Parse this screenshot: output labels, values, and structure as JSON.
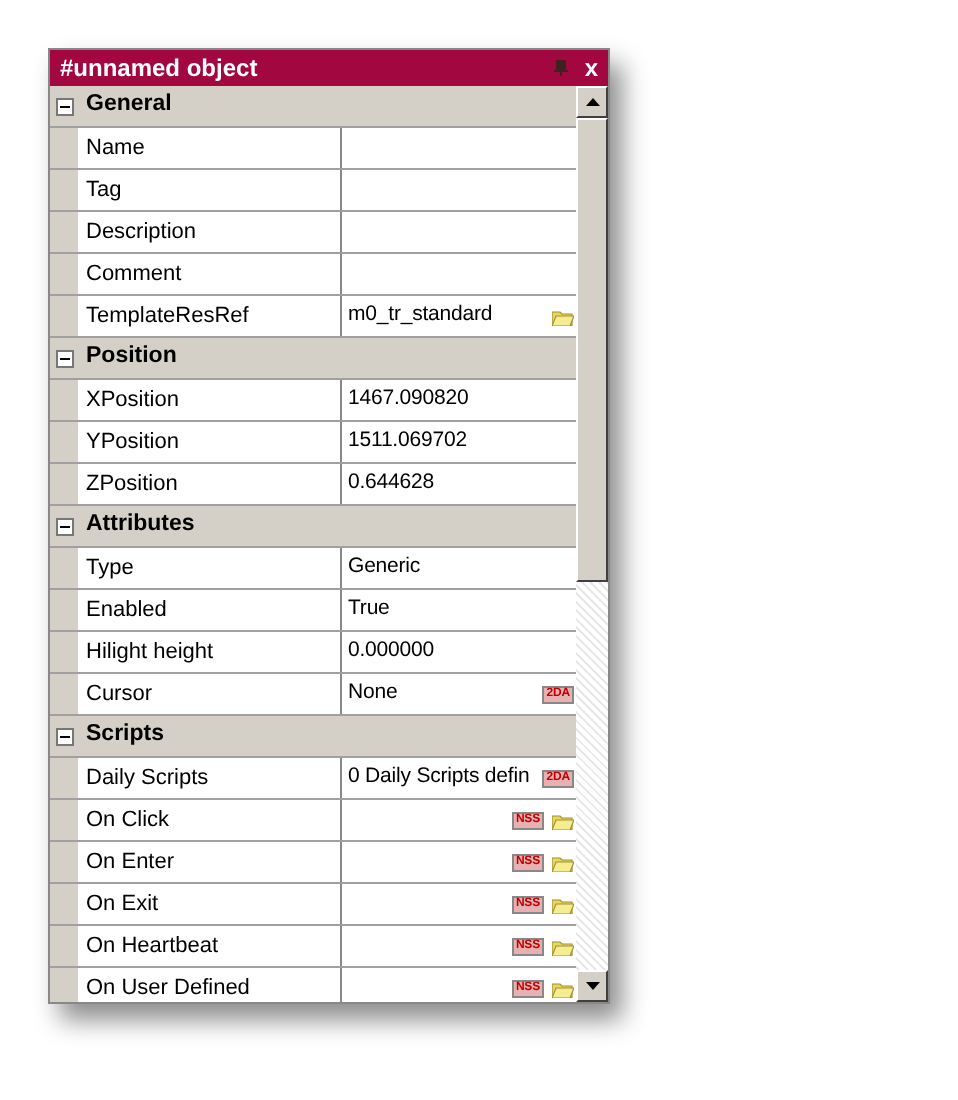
{
  "window": {
    "title": "#unnamed object",
    "close": "x"
  },
  "groups": [
    {
      "title": "General",
      "expanded": true,
      "rows": [
        {
          "name": "Name",
          "value": ""
        },
        {
          "name": "Tag",
          "value": ""
        },
        {
          "name": "Description",
          "value": ""
        },
        {
          "name": "Comment",
          "value": ""
        },
        {
          "name": "TemplateResRef",
          "value": "m0_tr_standard",
          "icons": [
            {
              "kind": "folder"
            }
          ]
        }
      ]
    },
    {
      "title": "Position",
      "expanded": true,
      "rows": [
        {
          "name": "XPosition",
          "value": "1467.090820"
        },
        {
          "name": "YPosition",
          "value": "1511.069702"
        },
        {
          "name": "ZPosition",
          "value": "0.644628"
        }
      ]
    },
    {
      "title": "Attributes",
      "expanded": true,
      "rows": [
        {
          "name": "Type",
          "value": "Generic"
        },
        {
          "name": "Enabled",
          "value": "True"
        },
        {
          "name": "Hilight height",
          "value": "0.000000"
        },
        {
          "name": "Cursor",
          "value": "None",
          "icons": [
            {
              "kind": "badge",
              "label": "2DA"
            }
          ]
        }
      ]
    },
    {
      "title": "Scripts",
      "expanded": true,
      "rows": [
        {
          "name": "Daily Scripts",
          "value": "0 Daily Scripts defin",
          "icons": [
            {
              "kind": "badge",
              "label": "2DA"
            }
          ]
        },
        {
          "name": "On Click",
          "value": "",
          "icons": [
            {
              "kind": "badge",
              "label": "NSS"
            },
            {
              "kind": "folder"
            }
          ]
        },
        {
          "name": "On Enter",
          "value": "",
          "icons": [
            {
              "kind": "badge",
              "label": "NSS"
            },
            {
              "kind": "folder"
            }
          ]
        },
        {
          "name": "On Exit",
          "value": "",
          "icons": [
            {
              "kind": "badge",
              "label": "NSS"
            },
            {
              "kind": "folder"
            }
          ]
        },
        {
          "name": "On Heartbeat",
          "value": "",
          "icons": [
            {
              "kind": "badge",
              "label": "NSS"
            },
            {
              "kind": "folder"
            }
          ]
        },
        {
          "name": "On User Defined",
          "value": "",
          "icons": [
            {
              "kind": "badge",
              "label": "NSS"
            },
            {
              "kind": "folder"
            }
          ]
        }
      ]
    }
  ]
}
